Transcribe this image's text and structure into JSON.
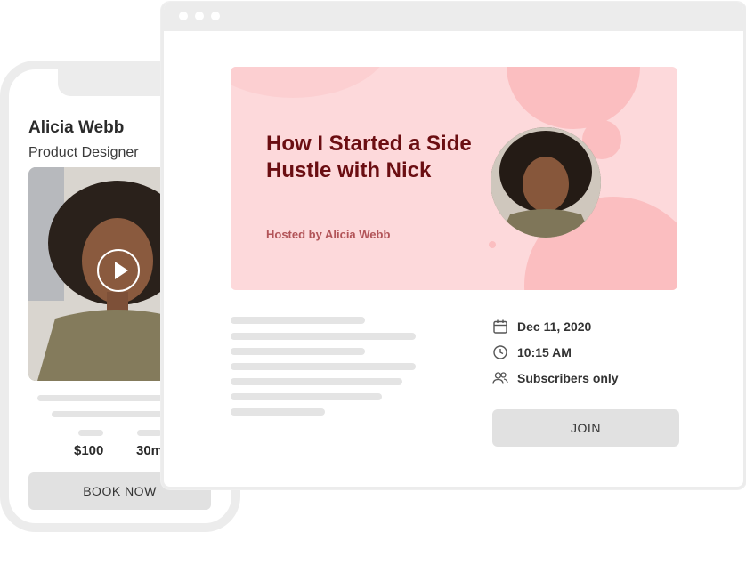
{
  "phone": {
    "name": "Alicia Webb",
    "role": "Product Designer",
    "price": "$100",
    "duration": "30m",
    "book_label": "BOOK NOW"
  },
  "event": {
    "title": "How I Started a Side Hustle with Nick",
    "host": "Hosted by Alicia Webb",
    "date": "Dec 11, 2020",
    "time": "10:15 AM",
    "audience": "Subscribers only",
    "join_label": "JOIN"
  },
  "icons": {
    "play": "play-icon",
    "calendar": "calendar-icon",
    "clock": "clock-icon",
    "users": "users-icon"
  },
  "colors": {
    "banner_bg": "#fdd9db",
    "banner_title": "#6b0e12",
    "banner_host": "#b25458",
    "button_bg": "#e1e1e1"
  }
}
